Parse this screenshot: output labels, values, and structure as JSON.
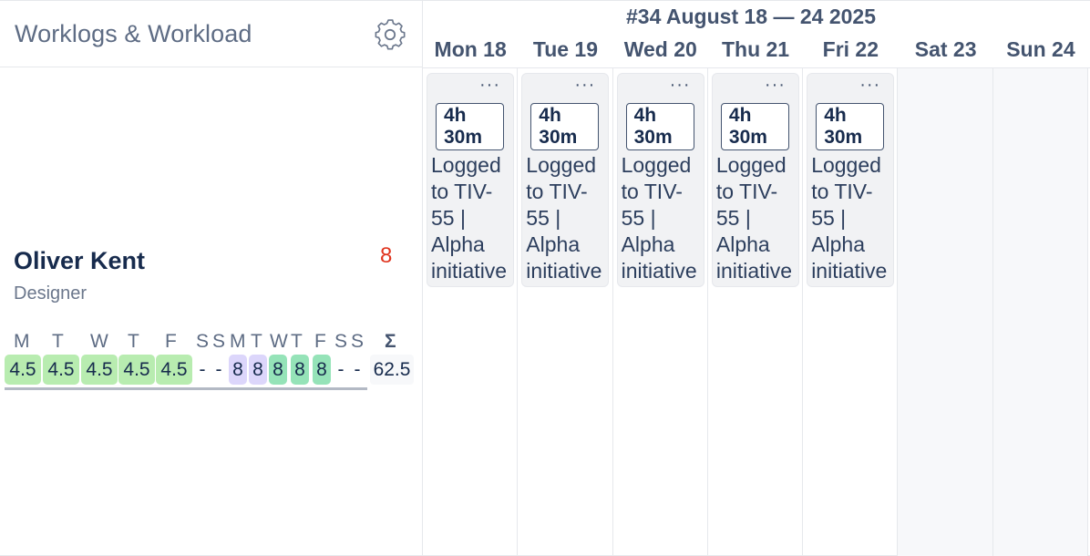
{
  "app": {
    "title": "Worklogs & Workload",
    "settings_icon": "gear-icon"
  },
  "week": {
    "title": "#34 August 18 — 24 2025",
    "days": [
      {
        "label": "Mon 18",
        "weekend": false
      },
      {
        "label": "Tue 19",
        "weekend": false
      },
      {
        "label": "Wed 20",
        "weekend": false
      },
      {
        "label": "Thu 21",
        "weekend": false
      },
      {
        "label": "Fri 22",
        "weekend": false
      },
      {
        "label": "Sat 23",
        "weekend": true
      },
      {
        "label": "Sun 24",
        "weekend": true
      }
    ]
  },
  "worklogs": [
    {
      "duration": "4h 30m",
      "text": "Logged to TIV-55 | Alpha initiative",
      "menu": "···"
    },
    {
      "duration": "4h 30m",
      "text": "Logged to TIV-55 | Alpha initiative",
      "menu": "···"
    },
    {
      "duration": "4h 30m",
      "text": "Logged to TIV-55 | Alpha initiative",
      "menu": "···"
    },
    {
      "duration": "4h 30m",
      "text": "Logged to TIV-55 | Alpha initiative",
      "menu": "···"
    },
    {
      "duration": "4h 30m",
      "text": "Logged to TIV-55 | Alpha initiative",
      "menu": "···"
    }
  ],
  "person": {
    "name": "Oliver Kent",
    "role": "Designer",
    "count": "8"
  },
  "workload": {
    "letters": [
      "M",
      "T",
      "W",
      "T",
      "F",
      "S",
      "S",
      "M",
      "T",
      "W",
      "T",
      "F",
      "S",
      "S"
    ],
    "sigma": "Σ",
    "values": [
      "4.5",
      "4.5",
      "4.5",
      "4.5",
      "4.5",
      "-",
      "-",
      "8",
      "8",
      "8",
      "8",
      "8",
      "-",
      "-"
    ],
    "kinds": [
      "green",
      "green",
      "green",
      "green",
      "green",
      "dash",
      "dash",
      "purple",
      "purple",
      "teal",
      "teal",
      "teal",
      "dash",
      "dash"
    ],
    "total": "62.5"
  }
}
